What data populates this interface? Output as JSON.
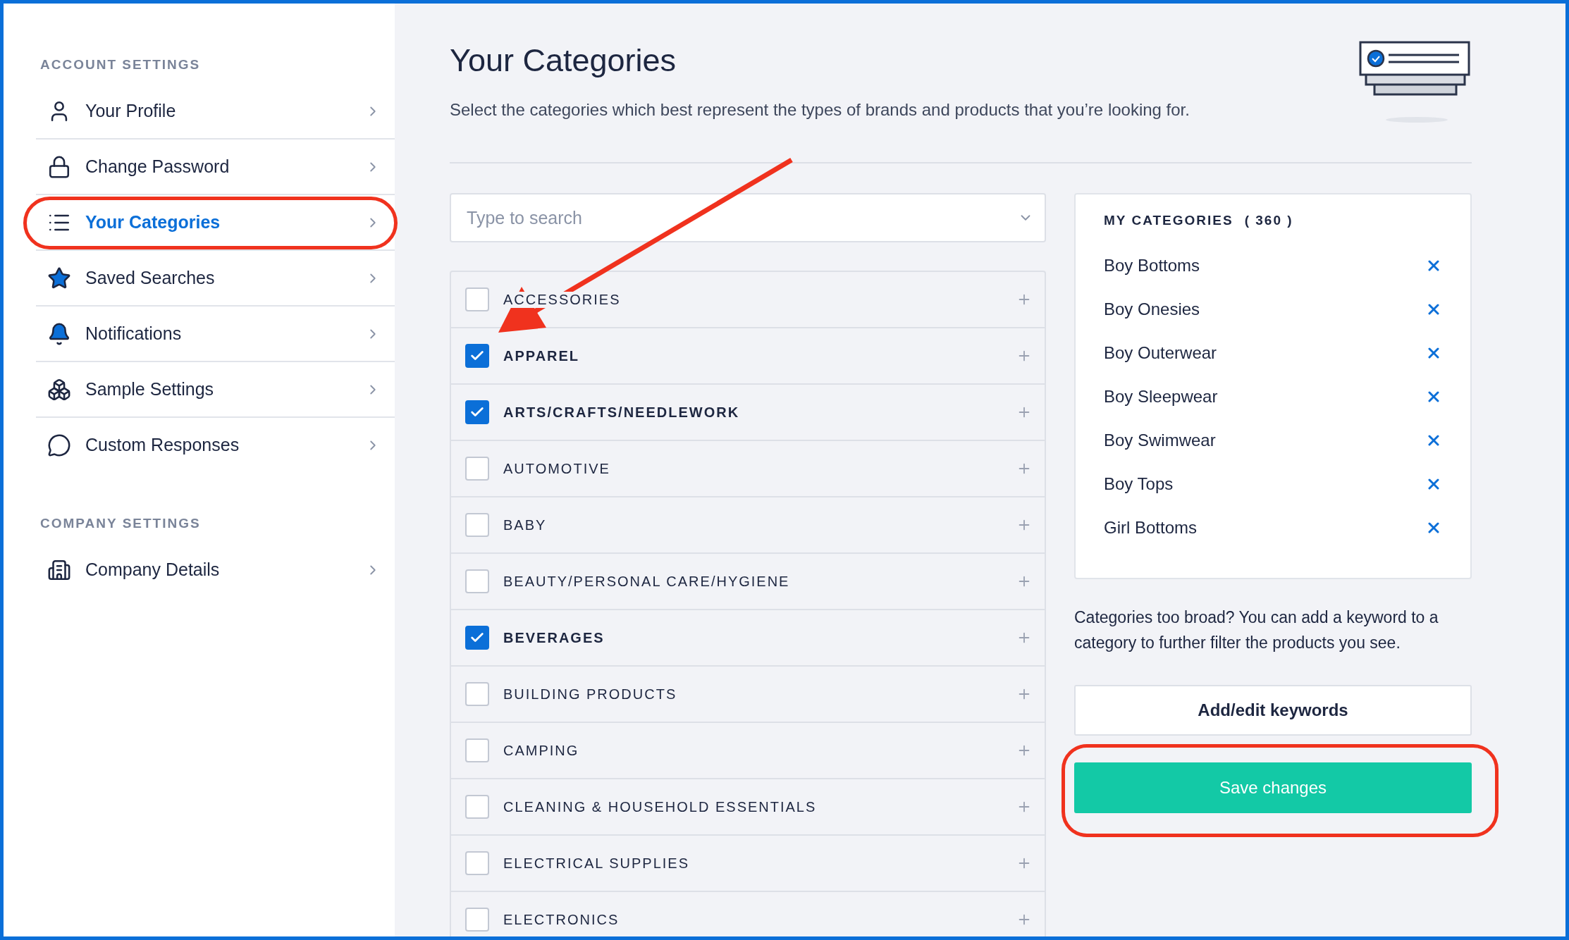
{
  "sidebar": {
    "sections": [
      {
        "title": "ACCOUNT SETTINGS",
        "items": [
          {
            "label": "Your Profile",
            "selected": false
          },
          {
            "label": "Change Password",
            "selected": false
          },
          {
            "label": "Your Categories",
            "selected": true
          },
          {
            "label": "Saved Searches",
            "selected": false
          },
          {
            "label": "Notifications",
            "selected": false
          },
          {
            "label": "Sample Settings",
            "selected": false
          },
          {
            "label": "Custom Responses",
            "selected": false
          }
        ]
      },
      {
        "title": "COMPANY SETTINGS",
        "items": [
          {
            "label": "Company Details",
            "selected": false
          }
        ]
      }
    ]
  },
  "page": {
    "title": "Your Categories",
    "subtitle": "Select the categories which best represent the types of brands and products that you’re looking for."
  },
  "search": {
    "placeholder": "Type to search"
  },
  "categories": [
    {
      "label": "ACCESSORIES",
      "checked": false
    },
    {
      "label": "APPAREL",
      "checked": true
    },
    {
      "label": "ARTS/CRAFTS/NEEDLEWORK",
      "checked": true
    },
    {
      "label": "AUTOMOTIVE",
      "checked": false
    },
    {
      "label": "BABY",
      "checked": false
    },
    {
      "label": "BEAUTY/PERSONAL CARE/HYGIENE",
      "checked": false
    },
    {
      "label": "BEVERAGES",
      "checked": true
    },
    {
      "label": "BUILDING PRODUCTS",
      "checked": false
    },
    {
      "label": "CAMPING",
      "checked": false
    },
    {
      "label": "CLEANING & HOUSEHOLD ESSENTIALS",
      "checked": false
    },
    {
      "label": "ELECTRICAL SUPPLIES",
      "checked": false
    },
    {
      "label": "ELECTRONICS",
      "checked": false
    }
  ],
  "my_categories": {
    "title": "MY CATEGORIES",
    "count": "( 360 )",
    "items": [
      "Boy Bottoms",
      "Boy Onesies",
      "Boy Outerwear",
      "Boy Sleepwear",
      "Boy Swimwear",
      "Boy Tops",
      "Girl Bottoms"
    ]
  },
  "keyword_hint": "Categories too broad? You can add a keyword to a category to further filter the products you see.",
  "buttons": {
    "keywords": "Add/edit keywords",
    "save": "Save changes"
  }
}
